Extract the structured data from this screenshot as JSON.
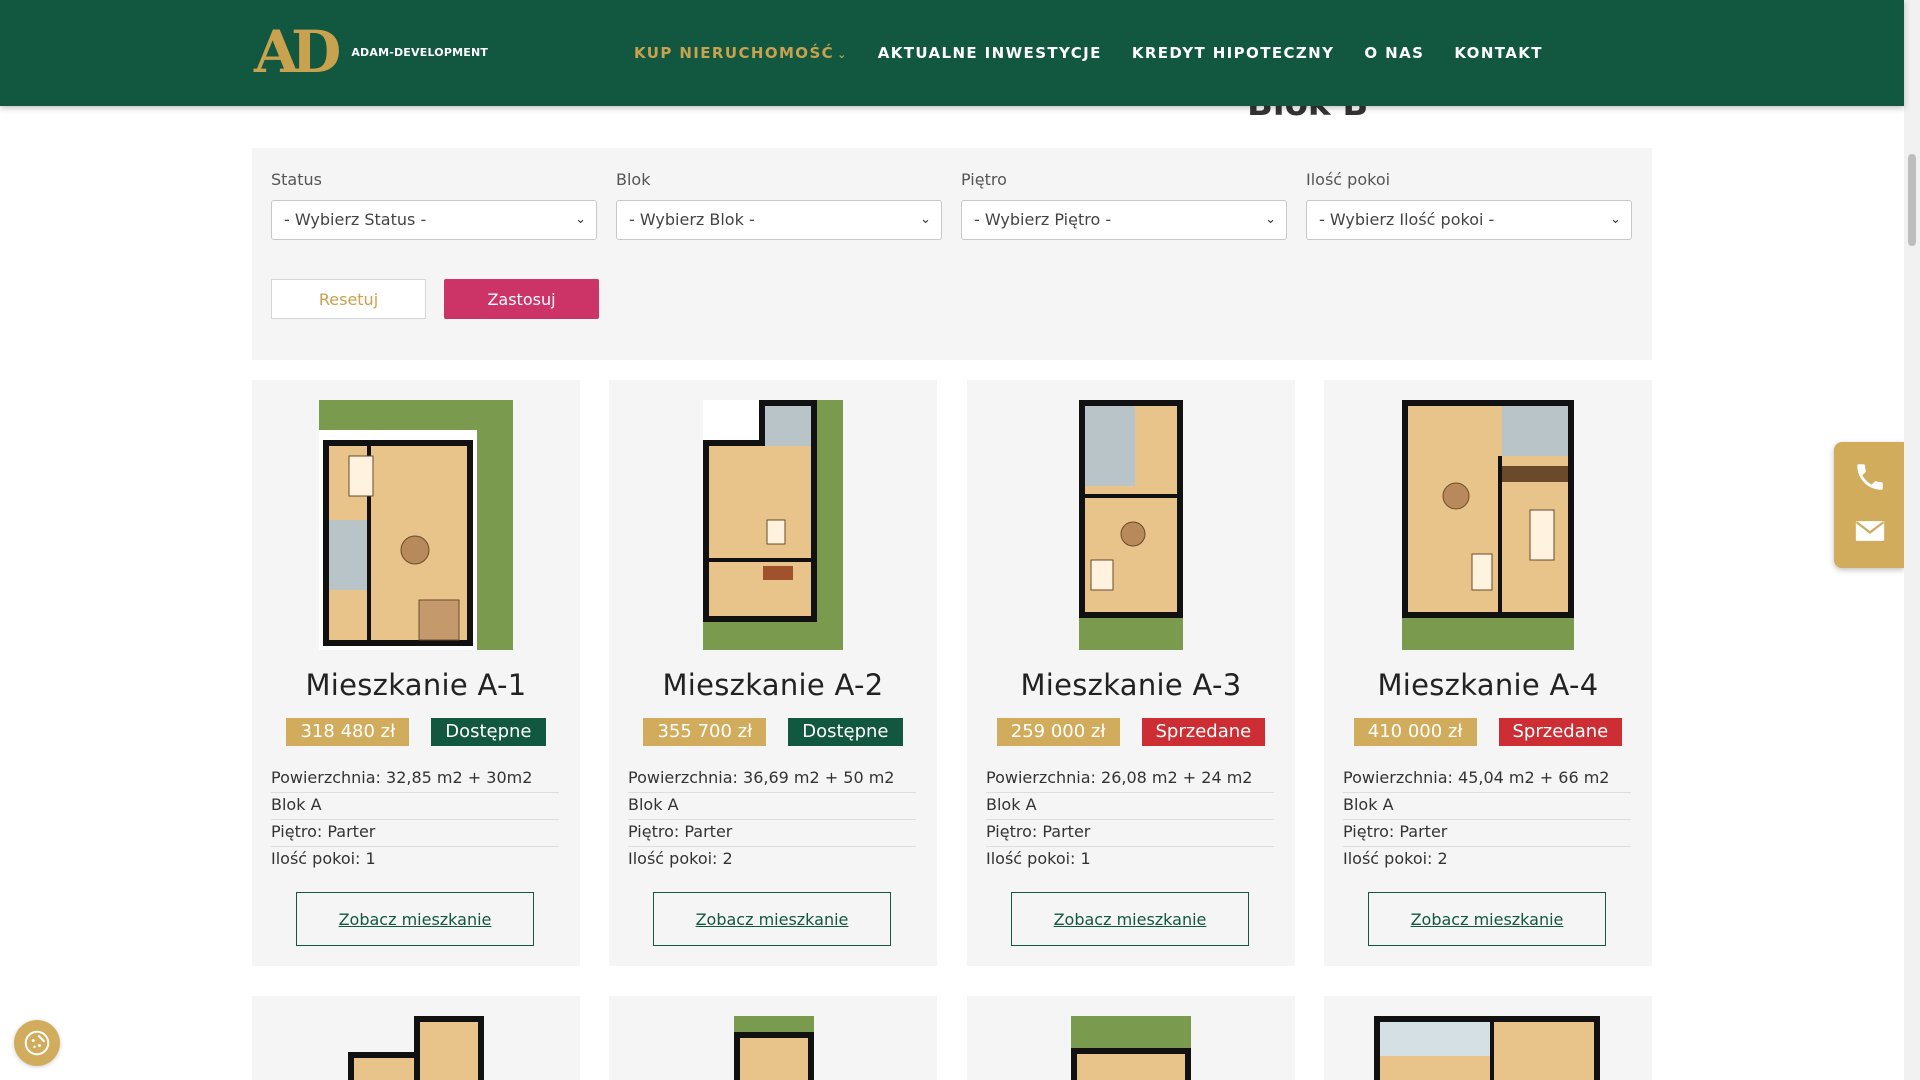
{
  "header": {
    "logo_mark": "AD",
    "logo_text": "ADAM-DEVELOPMENT",
    "nav": [
      {
        "label": "KUP NIERUCHOMOŚĆ",
        "active": true,
        "dropdown": true
      },
      {
        "label": "AKTUALNE INWESTYCJE"
      },
      {
        "label": "KREDYT HIPOTECZNY"
      },
      {
        "label": "O NAS"
      },
      {
        "label": "KONTAKT"
      }
    ]
  },
  "section_heading": "Blok B",
  "filters": {
    "status": {
      "label": "Status",
      "value": "- Wybierz Status -"
    },
    "blok": {
      "label": "Blok",
      "value": "- Wybierz Blok -"
    },
    "pietro": {
      "label": "Piętro",
      "value": "- Wybierz Piętro -"
    },
    "pokoje": {
      "label": "Ilość pokoi",
      "value": "- Wybierz Ilość pokoi -"
    },
    "reset_label": "Resetuj",
    "apply_label": "Zastosuj"
  },
  "apartments": [
    {
      "title": "Mieszkanie A-1",
      "price": "318 480 zł",
      "status": "Dostępne",
      "area": "Powierzchnia: 32,85 m2 + 30m2",
      "blok": "Blok A",
      "pietro": "Piętro: Parter",
      "pokoje": "Ilość pokoi: 1",
      "cta": "Zobacz mieszkanie"
    },
    {
      "title": "Mieszkanie A-2",
      "price": "355 700 zł",
      "status": "Dostępne",
      "area": "Powierzchnia: 36,69 m2 + 50 m2",
      "blok": "Blok A",
      "pietro": "Piętro: Parter",
      "pokoje": "Ilość pokoi: 2",
      "cta": "Zobacz mieszkanie"
    },
    {
      "title": "Mieszkanie A-3",
      "price": "259 000 zł",
      "status": "Sprzedane",
      "area": "Powierzchnia: 26,08 m2 + 24 m2",
      "blok": "Blok A",
      "pietro": "Piętro: Parter",
      "pokoje": "Ilość pokoi: 1",
      "cta": "Zobacz mieszkanie"
    },
    {
      "title": "Mieszkanie A-4",
      "price": "410 000 zł",
      "status": "Sprzedane",
      "area": "Powierzchnia: 45,04 m2 + 66 m2",
      "blok": "Blok A",
      "pietro": "Piętro: Parter",
      "pokoje": "Ilość pokoi: 2",
      "cta": "Zobacz mieszkanie"
    }
  ],
  "colors": {
    "brand_green": "#12573f",
    "gold": "#d1ac5c",
    "apply_pink": "#cc3366",
    "sold_red": "#cc2e34"
  },
  "icons": {
    "phone": "phone-icon",
    "mail": "mail-icon",
    "cookie": "cookie-settings-icon",
    "dropdown": "chevron-down-icon"
  }
}
